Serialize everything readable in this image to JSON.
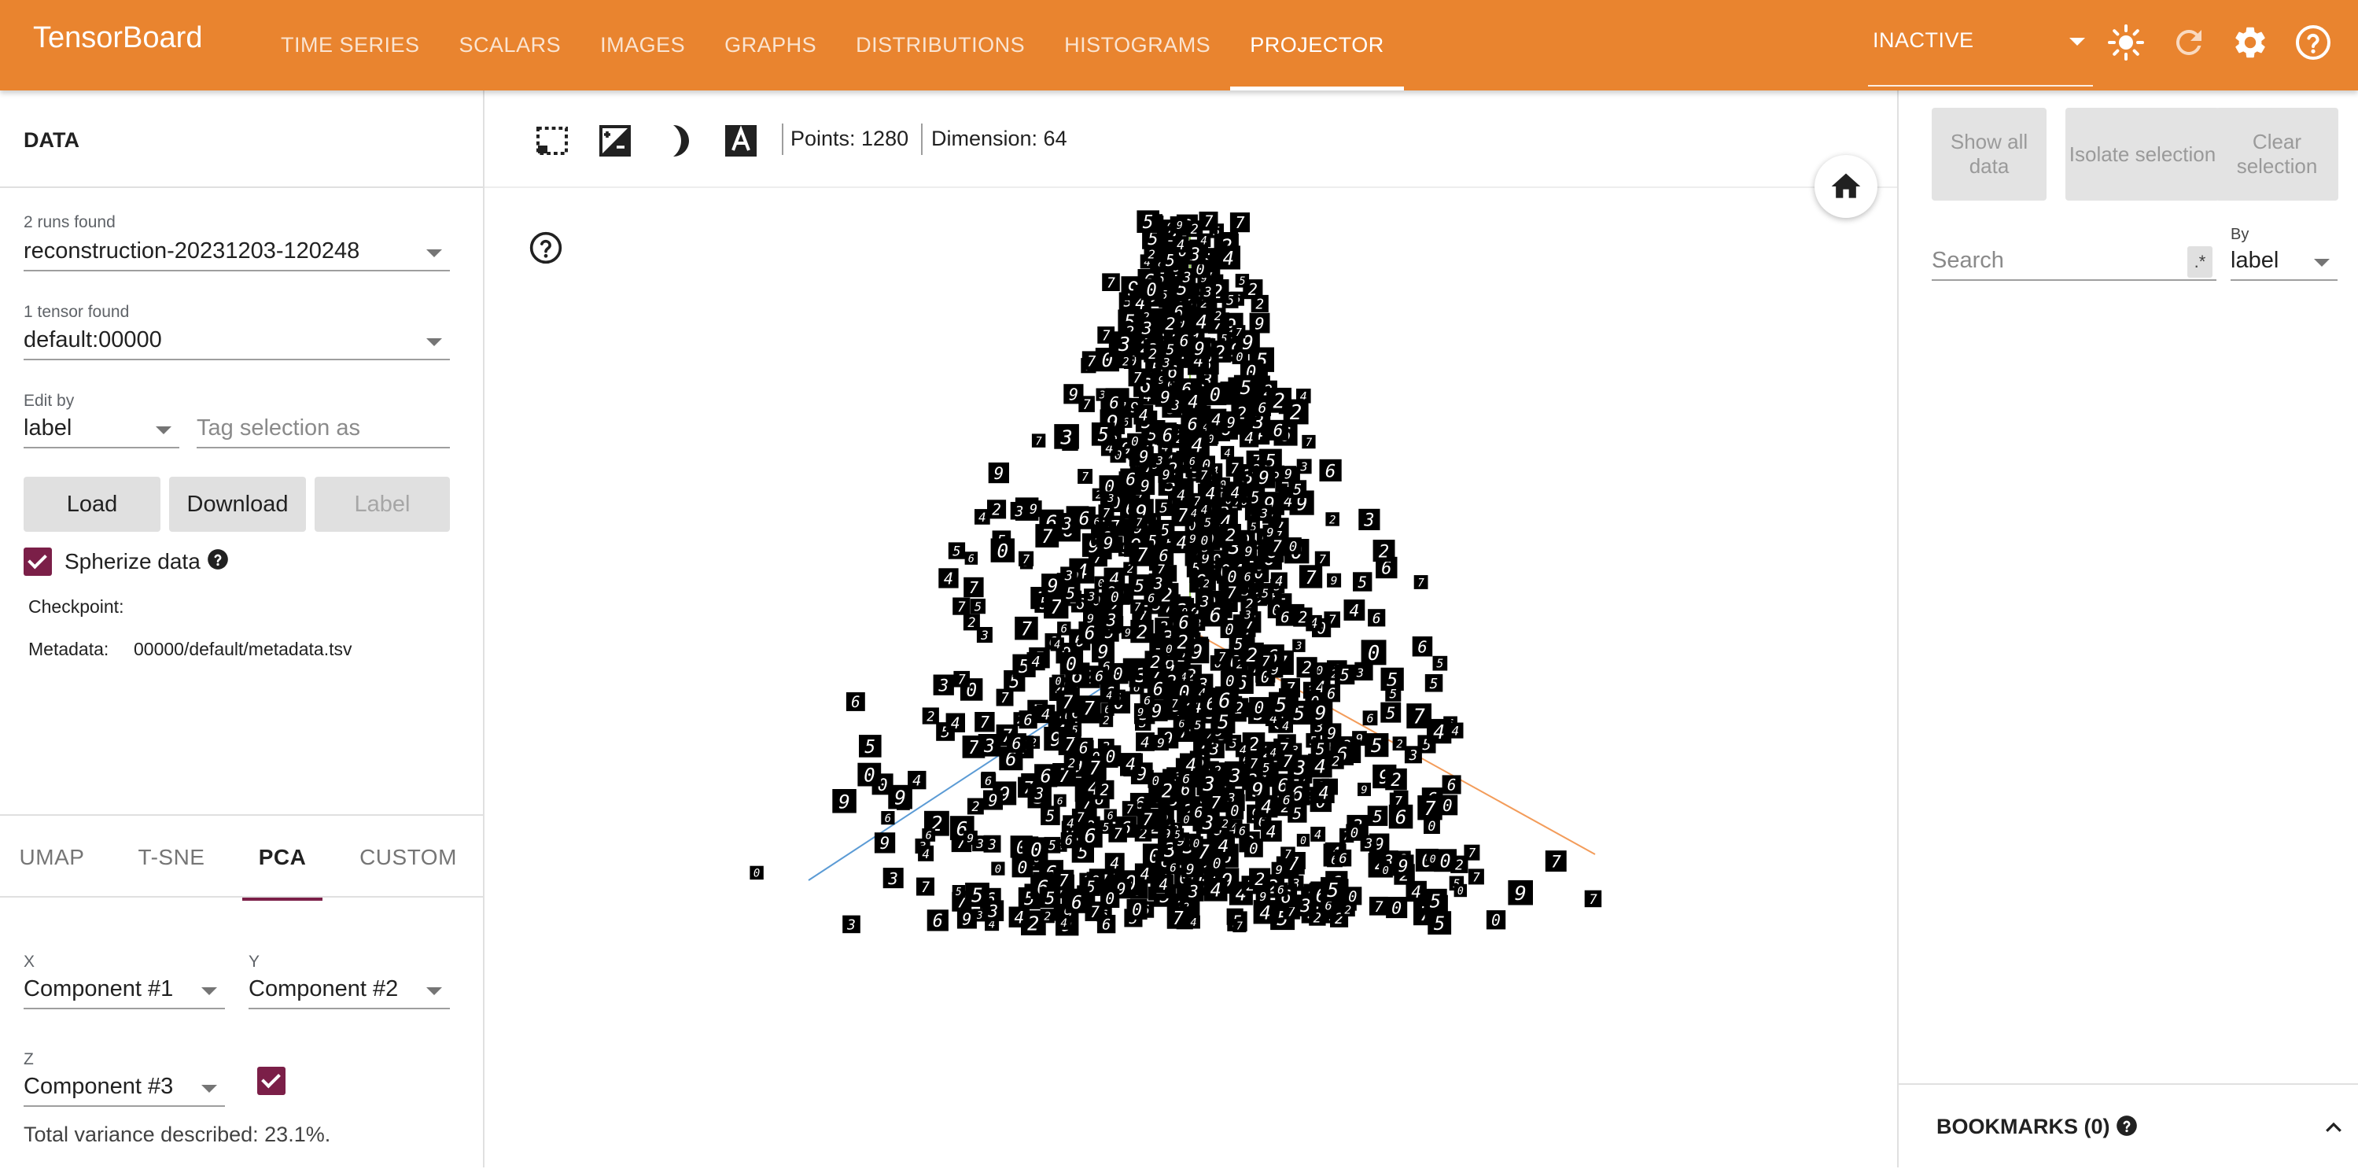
{
  "app": {
    "title": "TensorBoard"
  },
  "nav": {
    "tabs": [
      "TIME SERIES",
      "SCALARS",
      "IMAGES",
      "GRAPHS",
      "DISTRIBUTIONS",
      "HISTOGRAMS",
      "PROJECTOR"
    ],
    "active_tab": "PROJECTOR",
    "run_selector": "INACTIVE"
  },
  "data_panel": {
    "title": "DATA",
    "runs_found": "2 runs found",
    "run": "reconstruction-20231203-120248",
    "tensors_found": "1 tensor found",
    "tensor": "default:00000",
    "edit_by_label": "Edit by",
    "edit_by": "label",
    "tag_placeholder": "Tag selection as",
    "buttons": {
      "load": "Load",
      "download": "Download",
      "label": "Label"
    },
    "spherize_label": "Spherize data",
    "spherize_checked": true,
    "checkpoint_label": "Checkpoint:",
    "checkpoint_value": "",
    "metadata_label": "Metadata:",
    "metadata_value": "00000/default/metadata.tsv"
  },
  "projection": {
    "tabs": [
      "UMAP",
      "T-SNE",
      "PCA",
      "CUSTOM"
    ],
    "active": "PCA",
    "x_label": "X",
    "x_value": "Component #1",
    "y_label": "Y",
    "y_value": "Component #2",
    "z_label": "Z",
    "z_value": "Component #3",
    "z_checked": true,
    "variance": "Total variance described: 23.1%."
  },
  "toolbar": {
    "points": "Points: 1280",
    "dimension": "Dimension: 64"
  },
  "inspector": {
    "show_all": "Show all data",
    "isolate": "Isolate selection",
    "clear": "Clear selection",
    "search_placeholder": "Search",
    "regex_label": ".*",
    "by_label": "By",
    "by_value": "label",
    "bookmarks": "BOOKMARKS (0)"
  },
  "colors": {
    "accent": "#e9842f",
    "checkbox": "#7b1f48",
    "axis_x": "#f39c5a",
    "axis_y": "#9bd35a",
    "axis_z": "#5b9bd5"
  }
}
